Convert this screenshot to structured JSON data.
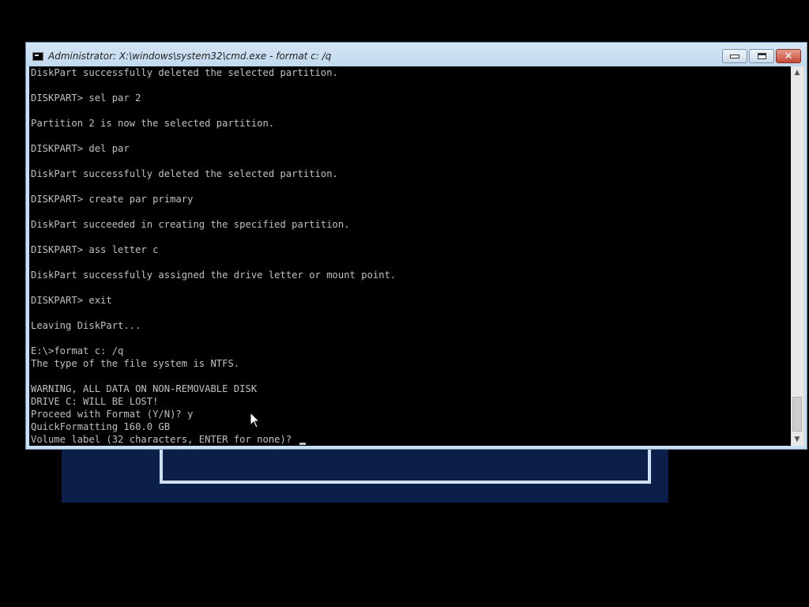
{
  "window": {
    "title": "Administrator: X:\\windows\\system32\\cmd.exe - format  c: /q",
    "close_glyph": "✕"
  },
  "console": {
    "lines": [
      "DiskPart successfully deleted the selected partition.",
      "",
      "DISKPART> sel par 2",
      "",
      "Partition 2 is now the selected partition.",
      "",
      "DISKPART> del par",
      "",
      "DiskPart successfully deleted the selected partition.",
      "",
      "DISKPART> create par primary",
      "",
      "DiskPart succeeded in creating the specified partition.",
      "",
      "DISKPART> ass letter c",
      "",
      "DiskPart successfully assigned the drive letter or mount point.",
      "",
      "DISKPART> exit",
      "",
      "Leaving DiskPart...",
      "",
      "E:\\>format c: /q",
      "The type of the file system is NTFS.",
      "",
      "WARNING, ALL DATA ON NON-REMOVABLE DISK",
      "DRIVE C: WILL BE LOST!",
      "Proceed with Format (Y/N)? y",
      "QuickFormatting 160.0 GB",
      "Volume label (32 characters, ENTER for none)? "
    ]
  },
  "scrollbar": {
    "up_arrow": "▲",
    "down_arrow": "▼"
  },
  "colors": {
    "console_background": "#000000",
    "console_text": "#c0c0c0",
    "title_bar": "#c9dff2",
    "setup_background": "#0b1f48"
  },
  "icons": [
    "cmd-icon",
    "minimize-icon",
    "maximize-icon",
    "close-icon",
    "mouse-pointer-icon"
  ]
}
